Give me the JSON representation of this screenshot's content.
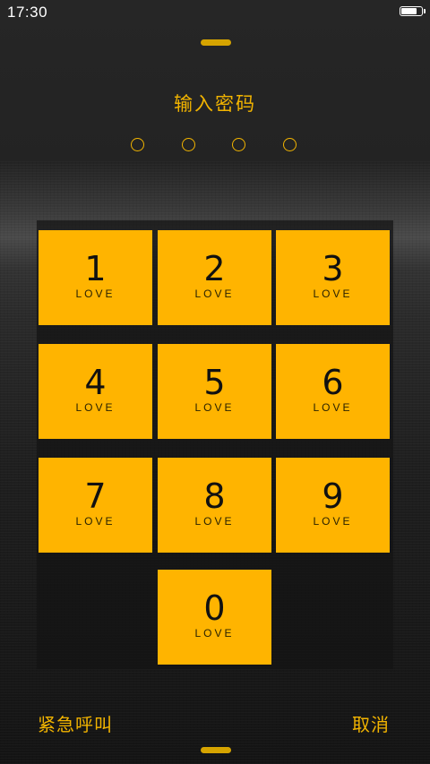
{
  "status_bar": {
    "time": "17:30",
    "battery_level": 0.8
  },
  "lock_screen": {
    "title": "输入密码",
    "pin_length": 4,
    "keys": [
      {
        "digit": "1",
        "sub": "LOVE"
      },
      {
        "digit": "2",
        "sub": "LOVE"
      },
      {
        "digit": "3",
        "sub": "LOVE"
      },
      {
        "digit": "4",
        "sub": "LOVE"
      },
      {
        "digit": "5",
        "sub": "LOVE"
      },
      {
        "digit": "6",
        "sub": "LOVE"
      },
      {
        "digit": "7",
        "sub": "LOVE"
      },
      {
        "digit": "8",
        "sub": "LOVE"
      },
      {
        "digit": "9",
        "sub": "LOVE"
      },
      {
        "digit": "0",
        "sub": "LOVE"
      }
    ],
    "emergency_label": "紧急呼叫",
    "cancel_label": "取消"
  },
  "colors": {
    "accent": "#ffb400",
    "text_accent": "#f2b400",
    "background": "#1c1c1c"
  }
}
